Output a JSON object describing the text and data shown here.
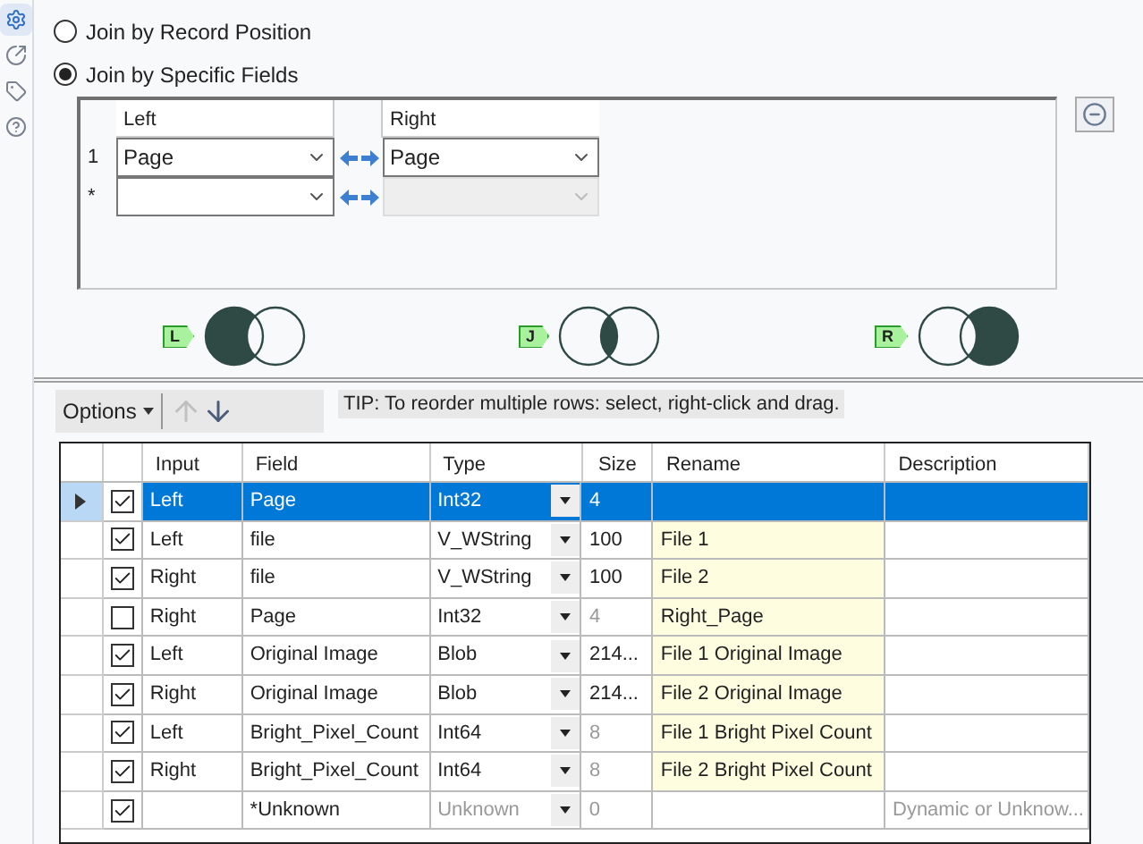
{
  "sidebar": [
    {
      "kind": "settings",
      "selected": true
    },
    {
      "kind": "output",
      "selected": false
    },
    {
      "kind": "tag",
      "selected": false
    },
    {
      "kind": "help",
      "selected": false
    }
  ],
  "join_modes": [
    {
      "label": "Join by Record Position",
      "selected": false
    },
    {
      "label": "Join by Specific Fields",
      "selected": true
    }
  ],
  "join_fields": {
    "columns": [
      "Left",
      "Right"
    ],
    "rows": [
      {
        "number": "1",
        "left": "Page",
        "right": "Page",
        "right_disabled": false
      },
      {
        "number": "*",
        "right_disabled": true
      }
    ]
  },
  "venns": [
    {
      "tag": "L",
      "kind": "left"
    },
    {
      "tag": "J",
      "kind": "inner"
    },
    {
      "tag": "R",
      "kind": "right"
    }
  ],
  "toolbar": {
    "options": "Options",
    "tip": "TIP: To reorder multiple rows: select, right-click and drag."
  },
  "table": {
    "columns": [
      "Input",
      "Field",
      "Type",
      "Size",
      "Rename",
      "Description"
    ],
    "rows": [
      {
        "selected": true,
        "checked": true,
        "input": "Left",
        "field": "Page",
        "type": "Int32",
        "type_fixed": false,
        "size": "4",
        "size_fixed": false
      },
      {
        "selected": false,
        "checked": true,
        "input": "Left",
        "field": "file",
        "type": "V_WString",
        "type_fixed": false,
        "size": "100",
        "size_fixed": false,
        "rename": "File 1"
      },
      {
        "selected": false,
        "checked": true,
        "input": "Right",
        "field": "file",
        "type": "V_WString",
        "type_fixed": false,
        "size": "100",
        "size_fixed": false,
        "rename": "File 2"
      },
      {
        "selected": false,
        "checked": false,
        "input": "Right",
        "field": "Page",
        "type": "Int32",
        "type_fixed": false,
        "size": "4",
        "size_fixed": true,
        "rename": "Right_Page"
      },
      {
        "selected": false,
        "checked": true,
        "input": "Left",
        "field": "Original Image",
        "type": "Blob",
        "type_fixed": false,
        "size": "214...",
        "size_fixed": false,
        "rename": "File 1 Original Image"
      },
      {
        "selected": false,
        "checked": true,
        "input": "Right",
        "field": "Original Image",
        "type": "Blob",
        "type_fixed": false,
        "size": "214...",
        "size_fixed": false,
        "rename": "File 2 Original Image"
      },
      {
        "selected": false,
        "checked": true,
        "input": "Left",
        "field": "Bright_Pixel_Count",
        "type": "Int64",
        "type_fixed": false,
        "size": "8",
        "size_fixed": true,
        "rename": "File 1 Bright Pixel Count"
      },
      {
        "selected": false,
        "checked": true,
        "input": "Right",
        "field": "Bright_Pixel_Count",
        "type": "Int64",
        "type_fixed": false,
        "size": "8",
        "size_fixed": true,
        "rename": "File 2 Bright Pixel Count"
      },
      {
        "selected": false,
        "checked": true,
        "field": "*Unknown",
        "type": "Unknown",
        "type_fixed": true,
        "size": "0",
        "size_fixed": true,
        "description": "Dynamic or Unknow..."
      }
    ]
  }
}
